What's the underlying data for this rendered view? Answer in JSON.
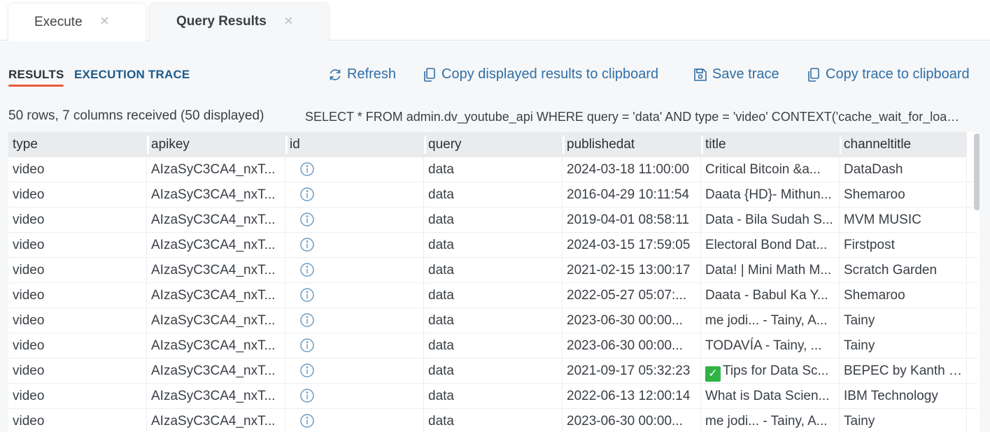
{
  "tabs": [
    {
      "label": "Execute",
      "close": "×"
    },
    {
      "label": "Query Results",
      "close": "×"
    }
  ],
  "subtabs": {
    "results": "RESULTS",
    "trace": "EXECUTION TRACE"
  },
  "actions": {
    "refresh": "Refresh",
    "copy_results": "Copy displayed results to clipboard",
    "save_trace": "Save trace",
    "copy_trace": "Copy trace to clipboard"
  },
  "summary": "50 rows, 7 columns received (50 displayed)",
  "sql": "SELECT * FROM admin.dv_youtube_api WHERE query = 'data' AND type = 'video' CONTEXT('cache_wait_for_load' = 'true')",
  "columns": [
    "type",
    "apikey",
    "id",
    "query",
    "publishedat",
    "title",
    "channeltitle"
  ],
  "rows": [
    {
      "type": "video",
      "apikey": "AIzaSyC3CA4_nxT...",
      "query": "data",
      "publishedat": "2024-03-18 11:00:00",
      "title": "Critical Bitcoin &a...",
      "channeltitle": "DataDash",
      "check": false
    },
    {
      "type": "video",
      "apikey": "AIzaSyC3CA4_nxT...",
      "query": "data",
      "publishedat": "2016-04-29 10:11:54",
      "title": "Daata {HD}- Mithun...",
      "channeltitle": "Shemaroo",
      "check": false
    },
    {
      "type": "video",
      "apikey": "AIzaSyC3CA4_nxT...",
      "query": "data",
      "publishedat": "2019-04-01 08:58:11",
      "title": "Data - Bila Sudah S...",
      "channeltitle": "MVM MUSIC",
      "check": false
    },
    {
      "type": "video",
      "apikey": "AIzaSyC3CA4_nxT...",
      "query": "data",
      "publishedat": "2024-03-15 17:59:05",
      "title": "Electoral Bond Dat...",
      "channeltitle": "Firstpost",
      "check": false
    },
    {
      "type": "video",
      "apikey": "AIzaSyC3CA4_nxT...",
      "query": "data",
      "publishedat": "2021-02-15 13:00:17",
      "title": "Data! | Mini Math M...",
      "channeltitle": "Scratch Garden",
      "check": false
    },
    {
      "type": "video",
      "apikey": "AIzaSyC3CA4_nxT...",
      "query": "data",
      "publishedat": "2022-05-27 05:07:...",
      "title": "Daata - Babul Ka Y...",
      "channeltitle": "Shemaroo",
      "check": false
    },
    {
      "type": "video",
      "apikey": "AIzaSyC3CA4_nxT...",
      "query": "data",
      "publishedat": "2023-06-30 00:00...",
      "title": "me jodi... - Tainy, A...",
      "channeltitle": "Tainy",
      "check": false
    },
    {
      "type": "video",
      "apikey": "AIzaSyC3CA4_nxT...",
      "query": "data",
      "publishedat": "2023-06-30 00:00...",
      "title": "TODAVÍA - Tainy, ...",
      "channeltitle": "Tainy",
      "check": false
    },
    {
      "type": "video",
      "apikey": "AIzaSyC3CA4_nxT...",
      "query": "data",
      "publishedat": "2021-09-17 05:32:23",
      "title": "Tips for Data Sc...",
      "channeltitle": "BEPEC by Kanth - ...",
      "check": true
    },
    {
      "type": "video",
      "apikey": "AIzaSyC3CA4_nxT...",
      "query": "data",
      "publishedat": "2022-06-13 12:00:14",
      "title": "What is Data Scien...",
      "channeltitle": "IBM Technology",
      "check": false
    },
    {
      "type": "video",
      "apikey": "AIzaSyC3CA4_nxT...",
      "query": "data",
      "publishedat": "2023-06-30 00:00...",
      "title": "me jodi... - Tainy, A...",
      "channeltitle": "Tainy",
      "check": false
    }
  ],
  "colors": {
    "accent_underline": "#e8593b",
    "link_blue": "#2f6fa8",
    "check_green": "#2fb344"
  }
}
